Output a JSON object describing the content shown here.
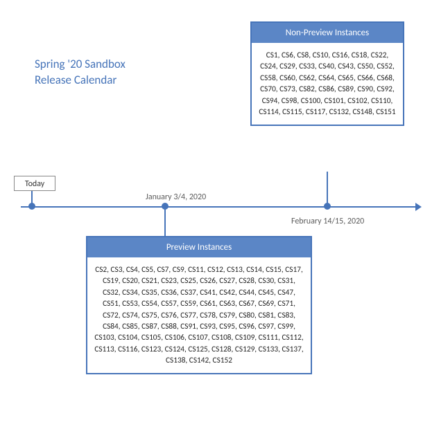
{
  "title_line1": "Spring '20 Sandbox",
  "title_line2": "Release Calendar",
  "today_label": "Today",
  "timeline": {
    "date1": "January 3/4, 2020",
    "date2": "February 14/15, 2020"
  },
  "non_preview": {
    "header": "Non-Preview Instances",
    "instances": [
      "CS1",
      "CS6",
      "CS8",
      "CS10",
      "CS16",
      "CS18",
      "CS22",
      "CS24",
      "CS29",
      "CS33",
      "CS40",
      "CS43",
      "CS50",
      "CS52",
      "CS58",
      "CS60",
      "CS62",
      "CS64",
      "CS65",
      "CS66",
      "CS68",
      "CS70",
      "CS73",
      "CS82",
      "CS86",
      "CS89",
      "CS90",
      "CS92",
      "CS94",
      "CS98",
      "CS100",
      "CS101",
      "CS102",
      "CS110",
      "CS114",
      "CS115",
      "CS117",
      "CS132",
      "CS148",
      "CS151"
    ]
  },
  "preview": {
    "header": "Preview Instances",
    "instances": [
      "CS2",
      "CS3",
      "CS4",
      "CS5",
      "CS7",
      "CS9",
      "CS11",
      "CS12",
      "CS13",
      "CS14",
      "CS15",
      "CS17",
      "CS19",
      "CS20",
      "CS21",
      "CS23",
      "CS25",
      "CS26",
      "CS27",
      "CS28",
      "CS30",
      "CS31",
      "CS32",
      "CS34",
      "CS35",
      "CS36",
      "CS37",
      "CS41",
      "CS42",
      "CS44",
      "CS45",
      "CS47",
      "CS51",
      "CS53",
      "CS54",
      "CS57",
      "CS59",
      "CS61",
      "CS63",
      "CS67",
      "CS69",
      "CS71",
      "CS72",
      "CS74",
      "CS75",
      "CS76",
      "CS77",
      "CS78",
      "CS79",
      "CS80",
      "CS81",
      "CS83",
      "CS84",
      "CS85",
      "CS87",
      "CS88",
      "CS91",
      "CS93",
      "CS95",
      "CS96",
      "CS97",
      "CS99",
      "CS103",
      "CS104",
      "CS105",
      "CS106",
      "CS107",
      "CS108",
      "CS109",
      "CS111",
      "CS112",
      "CS113",
      "CS116",
      "CS123",
      "CS124",
      "CS125",
      "CS128",
      "CS129",
      "CS133",
      "CS137",
      "CS138",
      "CS142",
      "CS152"
    ]
  }
}
